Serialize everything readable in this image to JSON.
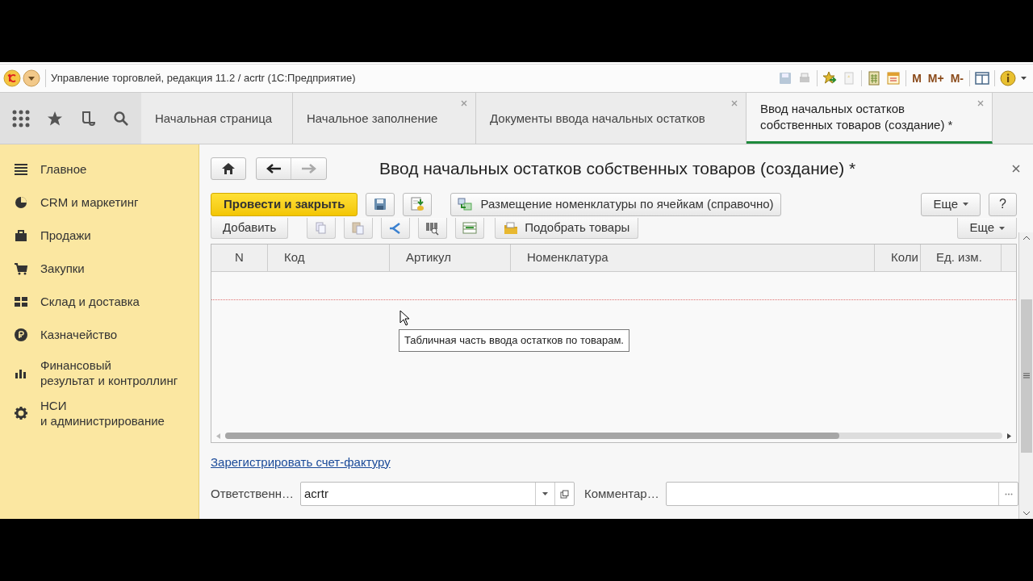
{
  "app_bar": {
    "title": "Управление торговлей, редакция 11.2 / acrtr  (1С:Предприятие)",
    "memory_buttons": [
      "M",
      "M+",
      "M-"
    ]
  },
  "tabs": [
    {
      "label": "Начальная страница",
      "closable": false,
      "selected": false
    },
    {
      "label": "Начальное заполнение",
      "closable": true,
      "selected": false
    },
    {
      "label": "Документы ввода начальных остатков",
      "closable": true,
      "selected": false
    },
    {
      "label": "Ввод начальных остатков\nсобственных товаров (создание) *",
      "closable": true,
      "selected": true
    }
  ],
  "sidebar": {
    "items": [
      {
        "label": "Главное"
      },
      {
        "label": "CRM и маркетинг"
      },
      {
        "label": "Продажи"
      },
      {
        "label": "Закупки"
      },
      {
        "label": "Склад и доставка"
      },
      {
        "label": "Казначейство"
      },
      {
        "label": "Финансовый\nрезультат и контроллинг"
      },
      {
        "label": "НСИ\nи администрирование"
      }
    ]
  },
  "form": {
    "title": "Ввод начальных остатков собственных товаров (создание) *",
    "primary_button": "Провести и закрыть",
    "placement_button": "Размещение номенклатуры по ячейкам (справочно)",
    "more_button": "Еще",
    "help_button": "?",
    "table_toolbar": {
      "add_button": "Добавить",
      "pick_button": "Подобрать товары",
      "more_button": "Еще"
    },
    "table": {
      "columns": [
        "N",
        "Код",
        "Артикул",
        "Номенклатура",
        "Коли",
        "Ед. изм."
      ],
      "tooltip": "Табличная часть ввода остатков по товарам."
    },
    "link": "Зарегистрировать счет-фактуру",
    "fields": [
      {
        "kind": "select",
        "label": "Ответственн…",
        "value": "acrtr"
      },
      {
        "kind": "text",
        "label": "Комментар…"
      }
    ]
  }
}
